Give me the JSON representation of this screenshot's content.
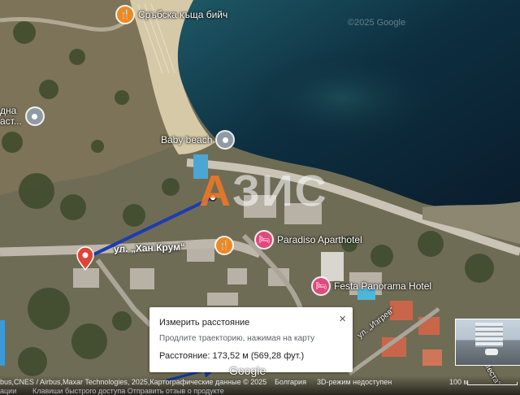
{
  "places": [
    {
      "id": "srabska",
      "name": "Сръбска къща бийч",
      "kind": "food"
    },
    {
      "id": "baby-beach",
      "name": "Baby beach",
      "kind": "poi"
    },
    {
      "id": "paradiso",
      "name": "Paradiso Aparthotel",
      "kind": "hotel"
    },
    {
      "id": "festa",
      "name": "Festa Panorama Hotel",
      "kind": "hotel"
    },
    {
      "id": "food-near-road",
      "name": "",
      "kind": "food"
    },
    {
      "id": "left-poi",
      "name": "дна\nаст...",
      "kind": "poi"
    }
  ],
  "streets": {
    "main": "ул. „Хан Крум“",
    "izgrev": "ул. „Изгрев“",
    "mesta": "„Места“"
  },
  "watermark_logo": "АЗИС",
  "copyright_watermark": "©2025 Google",
  "measure_popup": {
    "title": "Измерить расстояние",
    "hint": "Продлите траекторию, нажимая на карту",
    "distance_label": "Расстояние:",
    "distance_value": "173,52 м (569,28 фут.)",
    "close_symbol": "×"
  },
  "measurement": {
    "meters": 173.52,
    "feet": 569.28
  },
  "footer": {
    "attribution": "bus,CNES / Airbus,Maxar Technologies, 2025,Картографические данные © 2025",
    "country": "Болгария",
    "mode_3d": "3D-режим недоступен",
    "scale": "100 м",
    "row2_left": "ации",
    "row2_links": "Клавиши быстрого доступа   Отправить отзыв о продукте",
    "google": "Google"
  },
  "colors": {
    "route_line": "#1e3bb0",
    "annotation_arrow": "#123a9c",
    "pin_red": "#e04438",
    "food_pin": "#f0891d",
    "hotel_pin": "#e2487c",
    "logo_accent": "#f5781f"
  }
}
